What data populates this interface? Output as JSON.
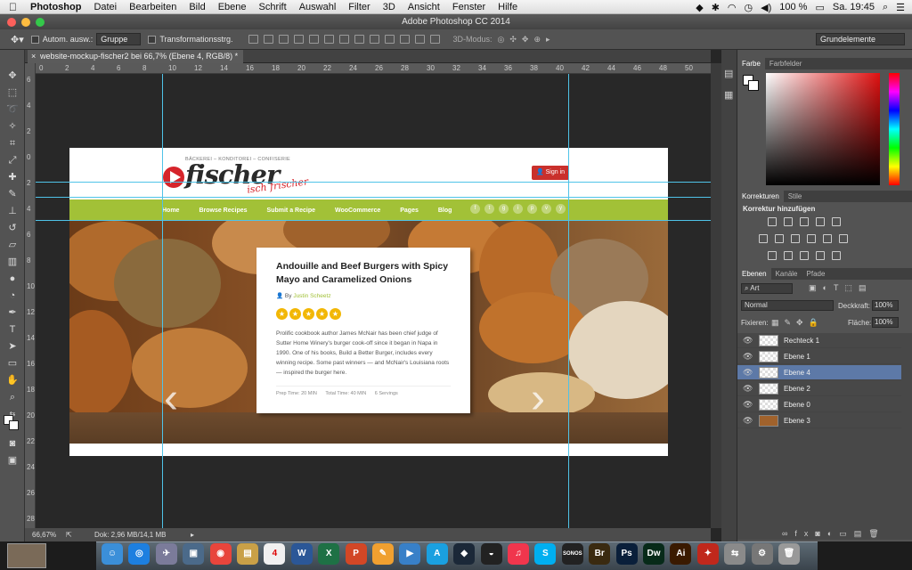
{
  "menubar": {
    "apple": "",
    "app": "Photoshop",
    "items": [
      "Datei",
      "Bearbeiten",
      "Bild",
      "Ebene",
      "Schrift",
      "Auswahl",
      "Filter",
      "3D",
      "Ansicht",
      "Fenster",
      "Hilfe"
    ],
    "battery": "100 %",
    "clock": "Sa. 19:45"
  },
  "window_title": "Adobe Photoshop CC 2014",
  "options": {
    "auto_select": "Autom. ausw.:",
    "group": "Gruppe",
    "transform": "Transformationsstrg.",
    "mode3d": "3D-Modus:",
    "workspace": "Grundelemente"
  },
  "doc_tab": {
    "close": "×",
    "title": "website-mockup-fischer2 bei 66,7% (Ebene 4, RGB/8) *"
  },
  "ruler_h": [
    "0",
    "2",
    "4",
    "6",
    "8",
    "10",
    "12",
    "14",
    "16",
    "18",
    "20",
    "22",
    "24",
    "26",
    "28",
    "30",
    "32",
    "34",
    "36",
    "38",
    "40",
    "42",
    "44",
    "46",
    "48",
    "50"
  ],
  "ruler_v": [
    "6",
    "4",
    "2",
    "0",
    "2",
    "4",
    "6",
    "8",
    "10",
    "12",
    "14",
    "16",
    "18",
    "20",
    "22",
    "24",
    "26",
    "28"
  ],
  "status": {
    "zoom": "66,67%",
    "doc": "Dok: 2,96 MB/14,1 MB"
  },
  "site": {
    "tagline": "BÄCKEREI – KONDITOREI – CONFISERIE",
    "logo": "fischer",
    "logo_sub": "isch frischer",
    "signin": "Sign in",
    "nav": [
      "Home",
      "Browse Recipes",
      "Submit a Recipe",
      "WooCommerce",
      "Pages",
      "Blog"
    ],
    "social": [
      "f",
      "t",
      "g",
      "i",
      "p",
      "v",
      "y"
    ],
    "card": {
      "title": "Andouille and Beef Burgers with Spicy Mayo and Caramelized Onions",
      "by": "By",
      "author": "Justin Scheetz",
      "desc": "Prolific cookbook author James McNair has been chief judge of Sutter Home Winery's burger cook-off since it began in Napa in 1990. One of his books, Build a Better Burger, includes every winning recipe. Some past winners — and McNair's Louisiana roots — inspired the burger here.",
      "prep": "Prep Time: 20 MIN",
      "total": "Total Time: 40 MIN",
      "servings": "6 Servings",
      "rating": 5
    }
  },
  "panels": {
    "color_tabs": [
      "Farbe",
      "Farbfelder"
    ],
    "adjust_tabs": [
      "Korrekturen",
      "Stile"
    ],
    "adjust_title": "Korrektur hinzufügen",
    "layer_tabs": [
      "Ebenen",
      "Kanäle",
      "Pfade"
    ],
    "filter": "Art",
    "blend": "Normal",
    "opacity_label": "Deckkraft:",
    "opacity": "100%",
    "lock_label": "Fixieren:",
    "fill_label": "Fläche:",
    "fill": "100%",
    "layers": [
      "Rechteck 1",
      "Ebene 1",
      "Ebene 4",
      "Ebene 2",
      "Ebene 0",
      "Ebene 3"
    ],
    "selected_layer": "Ebene 4"
  },
  "colors": {
    "accent_green": "#a2c137",
    "signin_red": "#c9302c",
    "star": "#f2b705",
    "guide": "#4fc3e8",
    "layer_selected": "#5d79a7"
  },
  "dock": [
    "Finder",
    "Safari",
    "Rocket",
    "Preview",
    "Chrome",
    "Notes",
    "Calendar",
    "Word",
    "Excel",
    "PowerPoint",
    "Pages",
    "Keynote",
    "App Store",
    "Steam",
    "Sonos",
    "Music",
    "Skype",
    "Sonos",
    "Bridge",
    "Photoshop",
    "Dreamweaver",
    "Illustrator",
    "Acrobat",
    "Migration",
    "Settings",
    "Trash"
  ],
  "dock_letters": [
    "☺",
    "◎",
    "✈",
    "▣",
    "◉",
    "▤",
    "4",
    "W",
    "X",
    "P",
    "✎",
    "▶",
    "A",
    "◆",
    "◒",
    "♫",
    "S",
    "SONOS",
    "Br",
    "Ps",
    "Dw",
    "Ai",
    "✦",
    "⇆",
    "⚙",
    "🗑"
  ]
}
